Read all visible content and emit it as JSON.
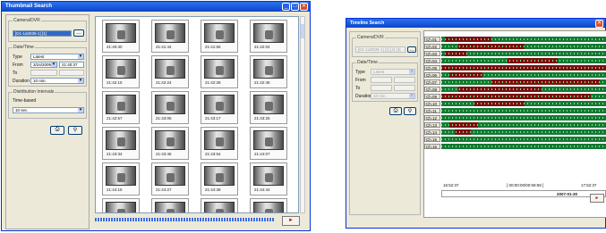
{
  "left_window": {
    "title": "Thumbnail Search",
    "camera_group": "Camera/DVR",
    "camera_value": "[D1-1a0035-1] [1]",
    "datetime_group": "Date/Time",
    "type_label": "Type",
    "type_value": "Latest",
    "from_label": "From",
    "from_date": "3/24/2009",
    "from_time": "21:40:37",
    "to_label": "To",
    "duration_label": "Duration",
    "duration_value": "10 min.",
    "dist_group": "Distribution Intervals",
    "time_based_label": "Time-based",
    "interval_value": "10 sec.",
    "thumbnails": [
      "21:40:30",
      "21:41:44",
      "21:41:55",
      "21:42:04",
      "21:42:15",
      "21:42:24",
      "21:42:28",
      "21:42:45",
      "21:42:57",
      "21:43:05",
      "21:43:17",
      "21:43:25",
      "21:43:34",
      "21:43:46",
      "21:43:54",
      "21:44:07",
      "21:44:15",
      "21:44:27",
      "21:44:38",
      "21:44:44",
      "",
      "",
      "",
      ""
    ],
    "play_label": "►",
    "close_label": "✕"
  },
  "right_window": {
    "title": "Timeline Search",
    "camera_group": "Camera/DVR",
    "camera_value": "[D1-1a0035-1] [1] [2] [3]",
    "datetime_group": "Date/Time",
    "type_label": "Type",
    "type_value": "Latest",
    "from_label": "From",
    "to_label": "To",
    "duration_label": "Duration",
    "duration_value": "10 min.",
    "channels": [
      "Ch.01",
      "Ch.02",
      "Ch.03",
      "Ch.04",
      "Ch.05",
      "Ch.06",
      "Ch.07",
      "Ch.08",
      "Ch.09",
      "Ch.10",
      "Ch.11",
      "Ch.12",
      "Ch.13",
      "Ch.14",
      "Ch.15",
      "Ch.16"
    ],
    "time_start": "16:52:37",
    "time_mid": "[ 00:00:00/00:59:59 ]",
    "time_end": "17:52:37",
    "date_label": "2007-01-30",
    "play_label": "►"
  },
  "colors": {
    "title_blue": "#0a46c8",
    "record_green": "#157a33",
    "event_red": "#7b0f0f"
  }
}
